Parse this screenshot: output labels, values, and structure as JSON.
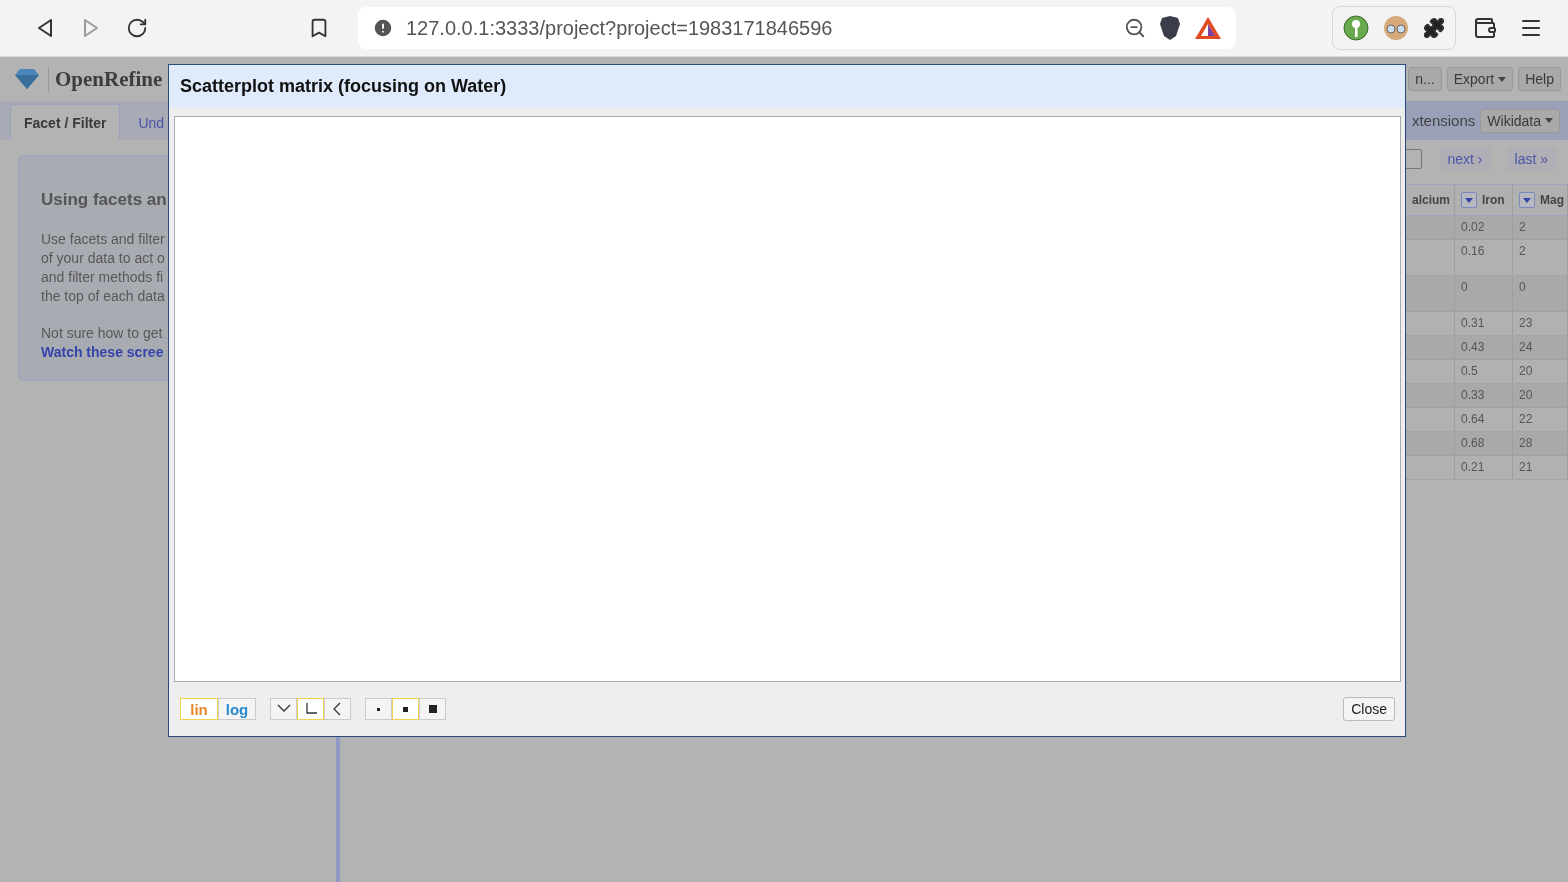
{
  "browser": {
    "url": "127.0.0.1:3333/project?project=1983171846596",
    "forward_disabled": true
  },
  "app": {
    "logo": "OpenRefine",
    "header_buttons": [
      {
        "label": "n...",
        "dropdown": false
      },
      {
        "label": "Export",
        "dropdown": true
      },
      {
        "label": "Help",
        "dropdown": false
      }
    ],
    "toolbar": {
      "label": "xtensions",
      "button": "Wikidata"
    },
    "tabs": [
      {
        "label": "Facet / Filter",
        "selected": true
      },
      {
        "label": "Und",
        "selected": false
      }
    ],
    "help": {
      "title": "Using facets an",
      "lines": [
        "Use facets and filter",
        "of your data to act o",
        "and filter methods fi",
        "the top of each data"
      ],
      "prompt": "Not sure how to get",
      "link": "Watch these scree"
    },
    "pager": [
      "next ›",
      "last »"
    ],
    "table": {
      "columns": [
        {
          "label": "alcium",
          "menu": false
        },
        {
          "label": "Iron",
          "menu": true
        },
        {
          "label": "Mag",
          "menu": true
        }
      ],
      "rows": [
        [
          "0.02",
          "2"
        ],
        [
          "0.16",
          "2"
        ],
        [
          "0",
          "0"
        ],
        [
          "0.31",
          "23"
        ],
        [
          "0.43",
          "24"
        ],
        [
          "0.5",
          "20"
        ],
        [
          "0.33",
          "20"
        ],
        [
          "0.64",
          "22"
        ],
        [
          "0.68",
          "28"
        ],
        [
          "0.21",
          "21"
        ]
      ]
    }
  },
  "dialog": {
    "title": "Scatterplot matrix (focusing on Water)",
    "scale": [
      {
        "label": "lin",
        "selected": true
      },
      {
        "label": "log",
        "selected": false
      }
    ],
    "rotation": [
      {
        "kind": "down",
        "selected": false
      },
      {
        "kind": "corner",
        "selected": true
      },
      {
        "kind": "left",
        "selected": false
      }
    ],
    "dot_size": [
      {
        "kind": "small",
        "selected": false
      },
      {
        "kind": "medium",
        "selected": true
      },
      {
        "kind": "large",
        "selected": false
      }
    ],
    "close": "Close"
  }
}
